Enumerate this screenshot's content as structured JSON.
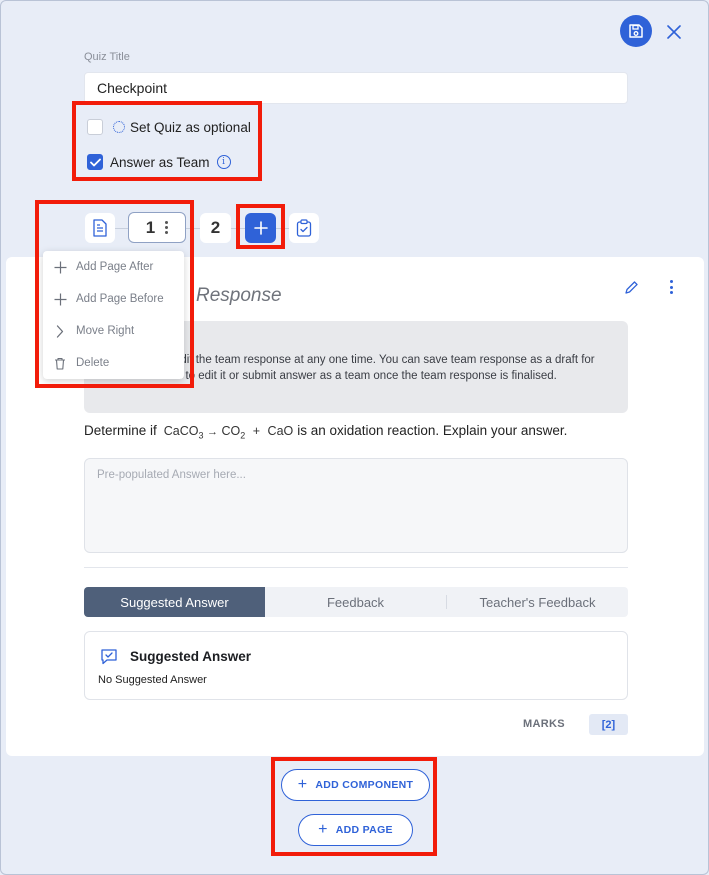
{
  "quiz": {
    "title_label": "Quiz Title",
    "title_value": "Checkpoint",
    "optional_label": "Set Quiz as optional",
    "team_label": "Answer as Team",
    "optional_checked": false,
    "team_checked": true
  },
  "pages": {
    "tabs": [
      "1",
      "2"
    ],
    "active_tab": "1"
  },
  "page_menu": {
    "items": [
      "Add Page After",
      "Add Page Before",
      "Move Right",
      "Delete"
    ]
  },
  "component": {
    "title": "Response",
    "info_text": "an edit the team response at any one time. You can save team response as a draft for other teammates to edit it or submit answer as a team once the team response is finalised.",
    "question_prefix": "Determine if",
    "formula_left": "CaCO",
    "formula_left_sub": "3",
    "formula_arrow": "→",
    "formula_right1": "CO",
    "formula_right1_sub": "2",
    "formula_plus": "+",
    "formula_right2": "CaO",
    "question_suffix": "is an oxidation reaction. Explain your answer.",
    "answer_placeholder": "Pre-populated Answer here...",
    "tabs": [
      "Suggested Answer",
      "Feedback",
      "Teacher's Feedback"
    ],
    "active_tab": "Suggested Answer",
    "suggested_title": "Suggested Answer",
    "suggested_body": "No Suggested Answer",
    "marks_label": "MARKS",
    "marks_value": "[2]"
  },
  "actions": {
    "add_component": "ADD COMPONENT",
    "add_page": "ADD PAGE"
  },
  "colors": {
    "accent": "#2f62d8",
    "highlight": "#f21c0a",
    "active_tab_bg": "#4f607a",
    "background": "#e8edf7"
  }
}
